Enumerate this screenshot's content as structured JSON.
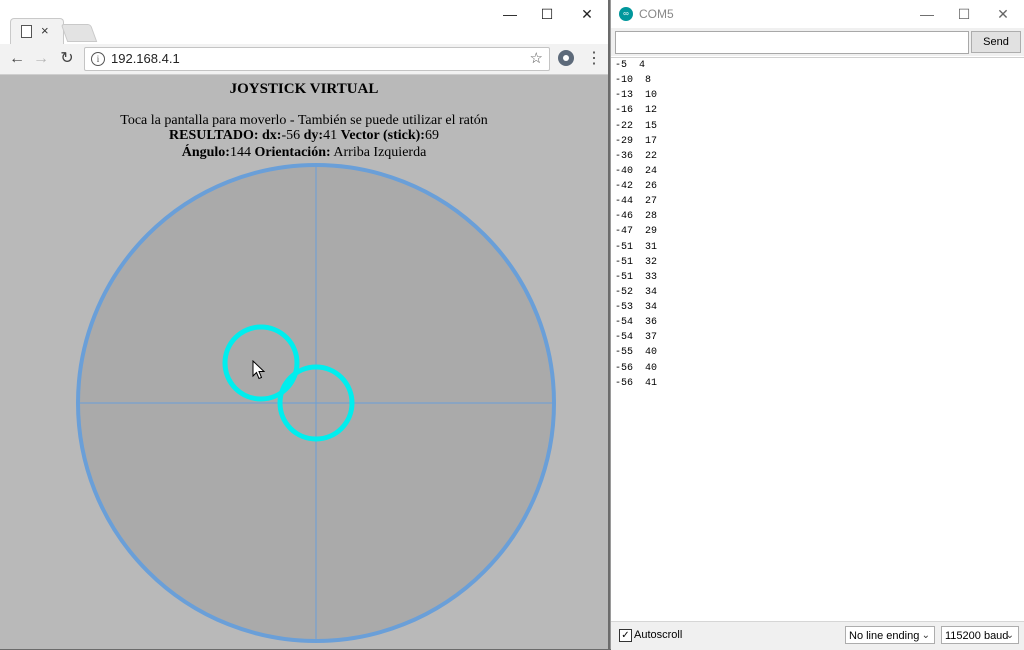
{
  "browser": {
    "tab_close": "×",
    "address": "192.168.4.1",
    "window_controls": {
      "minimize": "—",
      "maximize": "☐",
      "close": "✕"
    }
  },
  "page": {
    "title": "JOYSTICK VIRTUAL",
    "instruction": "Toca la pantalla para moverlo - También se puede utilizar el ratón",
    "resultado_label": "RESULTADO:",
    "dx_label": "dx:",
    "dx_value": "-56",
    "dy_label": "dy:",
    "dy_value": "41",
    "vector_label": "Vector (stick):",
    "vector_value": "69",
    "angulo_label": "Ángulo:",
    "angulo_value": "144",
    "orientacion_label": "Orientación:",
    "orientacion_value": "Arriba Izquierda",
    "colors": {
      "base_circle": "#6a9fd8",
      "stick_circle": "#00eeee",
      "base_fill": "#aaaaaa",
      "background": "#b9b9b9"
    }
  },
  "serial": {
    "title": "COM5",
    "input_value": "",
    "send_label": "Send",
    "window_controls": {
      "minimize": "—",
      "maximize": "☐",
      "close": "✕"
    },
    "lines": [
      "-5  4",
      "-10  8",
      "-13  10",
      "-16  12",
      "-22  15",
      "-29  17",
      "-36  22",
      "-40  24",
      "-42  26",
      "-44  27",
      "-46  28",
      "-47  29",
      "-51  31",
      "-51  32",
      "-51  33",
      "-52  34",
      "-53  34",
      "-54  36",
      "-54  37",
      "-55  40",
      "-56  40",
      "-56  41"
    ],
    "autoscroll_label": "Autoscroll",
    "autoscroll_checked": "✓",
    "line_ending": "No line ending",
    "baud": "115200 baud"
  }
}
